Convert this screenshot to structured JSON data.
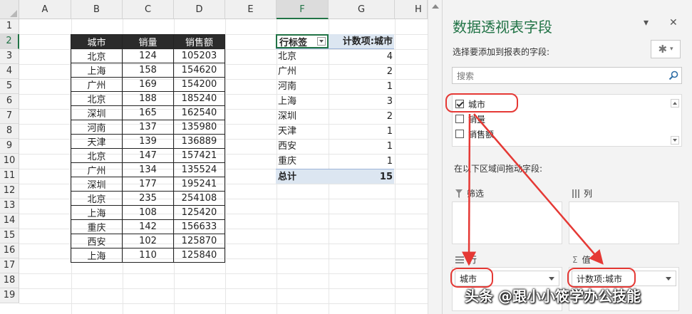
{
  "sheet": {
    "columns": [
      "A",
      "B",
      "C",
      "D",
      "E",
      "F",
      "G",
      "H"
    ],
    "selected_column": "F",
    "rows": [
      "1",
      "2",
      "3",
      "4",
      "5",
      "6",
      "7",
      "8",
      "9",
      "10",
      "11",
      "12",
      "13",
      "14",
      "15",
      "16",
      "17",
      "18",
      "19"
    ],
    "selected_row": "2"
  },
  "source_table": {
    "headers": [
      "城市",
      "销量",
      "销售额"
    ],
    "rows": [
      [
        "北京",
        "124",
        "105203"
      ],
      [
        "上海",
        "158",
        "154620"
      ],
      [
        "广州",
        "169",
        "154200"
      ],
      [
        "北京",
        "188",
        "185240"
      ],
      [
        "深圳",
        "165",
        "162540"
      ],
      [
        "河南",
        "137",
        "135980"
      ],
      [
        "天津",
        "139",
        "136889"
      ],
      [
        "北京",
        "147",
        "157421"
      ],
      [
        "广州",
        "134",
        "135524"
      ],
      [
        "深圳",
        "177",
        "195241"
      ],
      [
        "北京",
        "235",
        "254108"
      ],
      [
        "上海",
        "108",
        "125420"
      ],
      [
        "重庆",
        "142",
        "156633"
      ],
      [
        "西安",
        "102",
        "125870"
      ],
      [
        "上海",
        "110",
        "125840"
      ]
    ]
  },
  "pivot": {
    "row_label_header": "行标签",
    "value_header": "计数项:城市",
    "rows": [
      {
        "label": "北京",
        "value": "4"
      },
      {
        "label": "广州",
        "value": "2"
      },
      {
        "label": "河南",
        "value": "1"
      },
      {
        "label": "上海",
        "value": "3"
      },
      {
        "label": "深圳",
        "value": "2"
      },
      {
        "label": "天津",
        "value": "1"
      },
      {
        "label": "西安",
        "value": "1"
      },
      {
        "label": "重庆",
        "value": "1"
      }
    ],
    "total_label": "总计",
    "total_value": "15"
  },
  "field_pane": {
    "title": "数据透视表字段",
    "subtitle": "选择要添加到报表的字段:",
    "search_placeholder": "搜索",
    "fields": [
      {
        "label": "城市",
        "checked": true
      },
      {
        "label": "销量",
        "checked": false
      },
      {
        "label": "销售额",
        "checked": false
      }
    ],
    "drag_hint": "在以下区域间拖动字段:",
    "zones": {
      "filters": {
        "label": "筛选"
      },
      "columns": {
        "label": "列"
      },
      "rows": {
        "label": "行",
        "chip": "城市"
      },
      "values": {
        "label": "值",
        "chip": "计数项:城市"
      }
    },
    "close_glyph": "✕",
    "dropdown_glyph": "▾",
    "gear_glyph": "✱"
  },
  "annotation_color": "#e53935",
  "accent_color": "#217346",
  "watermark": "头条 @跟小小筱学办公技能"
}
